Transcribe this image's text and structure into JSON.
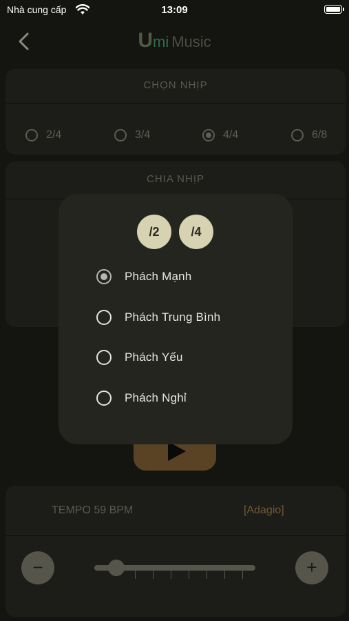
{
  "status_bar": {
    "carrier": "Nhà cung cấp",
    "time": "13:09"
  },
  "header": {
    "logo_u": "U",
    "logo_mi": "mi",
    "logo_music": "Music"
  },
  "chon_nhip": {
    "title": "CHỌN NHỊP",
    "options": [
      {
        "label": "2/4",
        "selected": false
      },
      {
        "label": "3/4",
        "selected": false
      },
      {
        "label": "4/4",
        "selected": true
      },
      {
        "label": "6/8",
        "selected": false
      }
    ]
  },
  "chia_nhip": {
    "title": "CHIA NHỊP"
  },
  "modal": {
    "note_buttons": [
      "/2",
      "/4"
    ],
    "options": [
      {
        "label": "Phách Mạnh",
        "selected": true
      },
      {
        "label": "Phách Trung Bình",
        "selected": false
      },
      {
        "label": "Phách Yếu",
        "selected": false
      },
      {
        "label": "Phách Nghỉ",
        "selected": false
      }
    ]
  },
  "tempo": {
    "label": "TEMPO 59 BPM",
    "marking": "[Adagio]",
    "minus": "−",
    "plus": "+",
    "slider_fraction": 0.09
  }
}
